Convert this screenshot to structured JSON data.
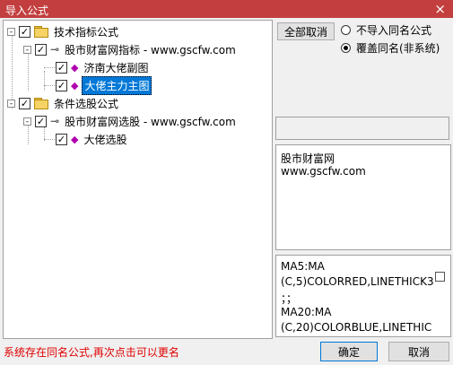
{
  "window": {
    "title": "导入公式",
    "close_glyph": "×"
  },
  "tree": {
    "nodes": [
      {
        "id": "n1",
        "label": "技术指标公式",
        "icon": "folder-icon",
        "expander": "-",
        "checked": true
      },
      {
        "id": "n2",
        "label": "股市财富网指标 - www.gscfw.com",
        "icon": "key-icon",
        "expander": "-",
        "checked": true
      },
      {
        "id": "n3",
        "label": "济南大佬副图",
        "icon": "formula-diamond-icon",
        "checked": true
      },
      {
        "id": "n4",
        "label": "大佬主力主图",
        "icon": "formula-diamond-icon",
        "checked": true,
        "selected": true
      },
      {
        "id": "n5",
        "label": "条件选股公式",
        "icon": "folder-icon",
        "expander": "-",
        "checked": true
      },
      {
        "id": "n6",
        "label": "股市财富网选股 - www.gscfw.com",
        "icon": "key-icon",
        "expander": "-",
        "checked": true
      },
      {
        "id": "n7",
        "label": "大佬选股",
        "icon": "formula-diamond-icon",
        "checked": true
      }
    ]
  },
  "options": {
    "cancel_all_label": "全部取消",
    "radio_no_import": "不导入同名公式",
    "radio_overwrite": "覆盖同名(非系统)",
    "selected_option": "覆盖同名(非系统)"
  },
  "description": {
    "line1": "股市财富网",
    "line2": "www.gscfw.com"
  },
  "code_preview": {
    "lines": [
      "MA5:MA",
      "(C,5)COLORRED,LINETHICK3",
      "；；",
      "MA20:MA",
      "(C,20)COLORBLUE,LINETHIC"
    ]
  },
  "status_text": "系统存在同名公式,再次点击可以更名",
  "buttons": {
    "ok": "确定",
    "cancel": "取消"
  },
  "glyphs": {
    "check": "✓",
    "diamond": "◆",
    "key": "⊸"
  }
}
